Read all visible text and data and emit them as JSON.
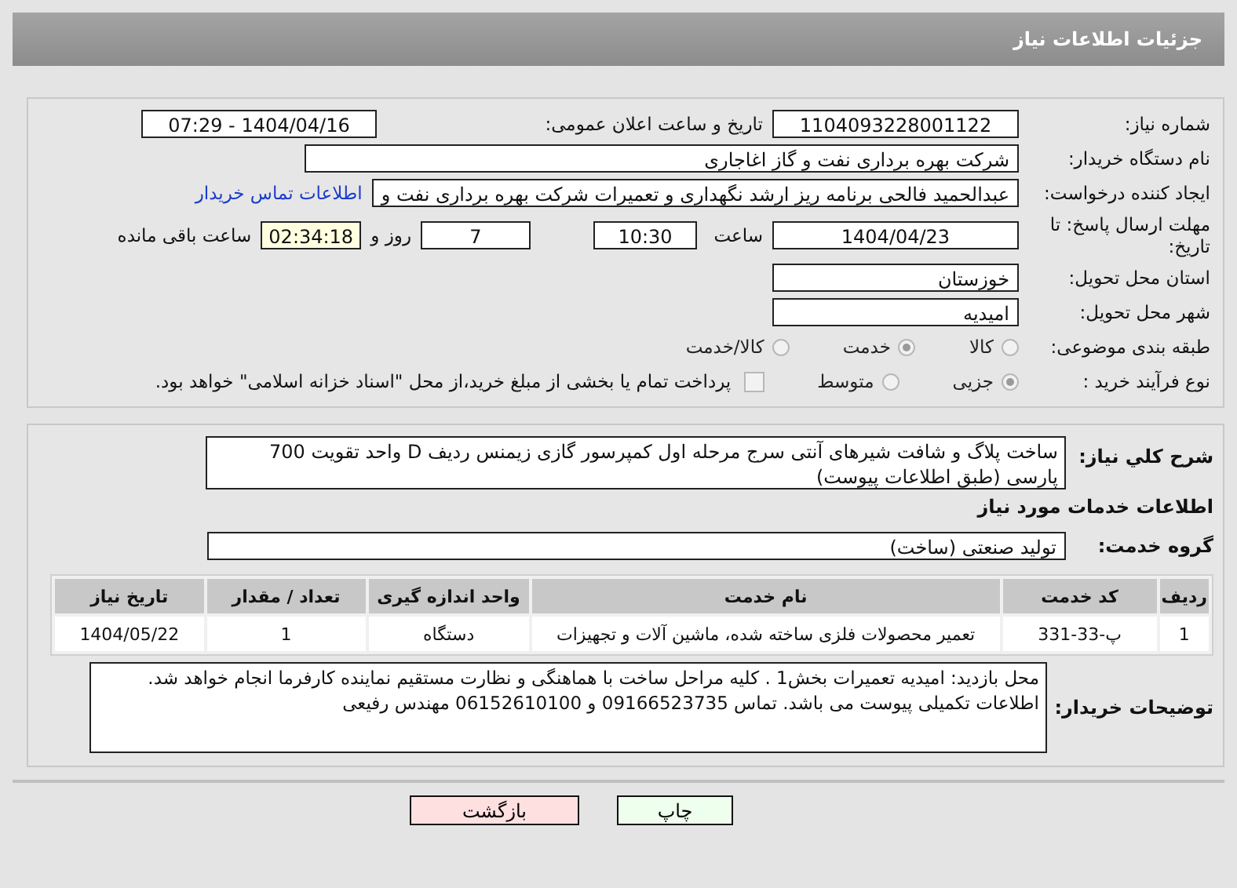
{
  "header": {
    "title": "جزئیات اطلاعات نیاز"
  },
  "need_number": {
    "label": "شماره نیاز:",
    "value": "1104093228001122"
  },
  "announce": {
    "label": "تاریخ و ساعت اعلان عمومی:",
    "value": "1404/04/16 - 07:29"
  },
  "buyer": {
    "label": "نام دستگاه خریدار:",
    "value": "شرکت بهره برداری نفت و گاز اغاجاری"
  },
  "creator": {
    "label": "ایجاد کننده درخواست:",
    "value": "عبدالحمید فالحی برنامه ریز ارشد نگهداری و تعمیرات شرکت بهره برداری نفت و",
    "link": "اطلاعات تماس خریدار"
  },
  "deadline": {
    "label": "مهلت ارسال پاسخ: تا تاریخ:",
    "date": "1404/04/23",
    "time_label": "ساعت",
    "time": "10:30",
    "days": "7",
    "days_label": "روز و",
    "remaining": "02:34:18",
    "remaining_label": "ساعت باقی مانده"
  },
  "province": {
    "label": "استان محل تحویل:",
    "value": "خوزستان"
  },
  "city": {
    "label": "شهر محل تحویل:",
    "value": "امیدیه"
  },
  "category": {
    "label": "طبقه بندی موضوعی:",
    "options": [
      {
        "label": "کالا",
        "selected": false
      },
      {
        "label": "خدمت",
        "selected": true
      },
      {
        "label": "کالا/خدمت",
        "selected": false
      }
    ]
  },
  "process": {
    "label": "نوع فرآیند خرید :",
    "options": [
      {
        "label": "جزیی",
        "selected": true
      },
      {
        "label": "متوسط",
        "selected": false
      }
    ],
    "payment": {
      "checked": false,
      "text": "پرداخت تمام یا بخشی از مبلغ خرید،از محل \"اسناد خزانه اسلامی\" خواهد بود."
    }
  },
  "description": {
    "label": "شرح کلي نياز:",
    "value": "ساخت پلاگ و شافت شیرهای آنتی سرج مرحله اول کمپرسور گازی زیمنس ردیف D واحد تقویت 700 پارسی (طبق اطلاعات پیوست)"
  },
  "services_title": "اطلاعات خدمات مورد نیاز",
  "service_group": {
    "label": "گروه خدمت:",
    "value": "تولید صنعتی (ساخت)"
  },
  "table": {
    "columns": [
      "ردیف",
      "کد خدمت",
      "نام خدمت",
      "واحد اندازه گیری",
      "تعداد / مقدار",
      "تاریخ نیاز"
    ],
    "rows": [
      [
        "1",
        "پ-33-331",
        "تعمیر محصولات فلزی ساخته شده، ماشین آلات و تجهیزات",
        "دستگاه",
        "1",
        "1404/05/22"
      ]
    ]
  },
  "notes": {
    "label": "توضیحات خریدار:",
    "value": "محل بازدید: امیدیه تعمیرات بخش1 . کلیه مراحل ساخت با هماهنگی و نظارت مستقیم نماینده کارفرما انجام خواهد شد.\nاطلاعات تکمیلی پیوست می باشد. تماس 09166523735 و 06152610100 مهندس رفیعی"
  },
  "buttons": [
    {
      "label": "چاپ",
      "kind": "print"
    },
    {
      "label": "بازگشت",
      "kind": "back"
    }
  ]
}
